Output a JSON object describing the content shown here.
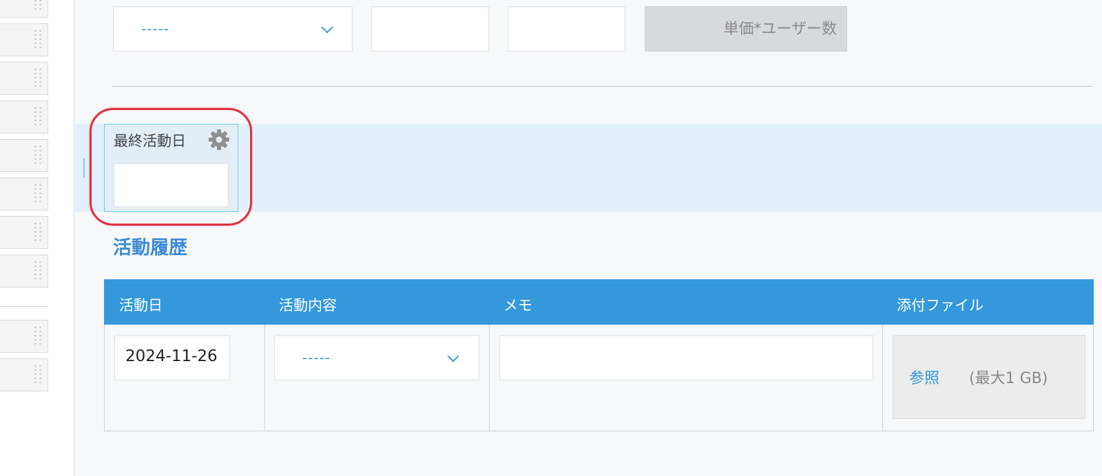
{
  "form": {
    "top_row": {
      "select_value": "-----",
      "calc_field_text": "単価*ユーザー数"
    },
    "selected_field": {
      "label": "最終活動日",
      "icon": "gear-icon"
    },
    "section_title": "活動履歴",
    "table": {
      "headers": [
        "活動日",
        "活動内容",
        "メモ",
        "添付ファイル"
      ],
      "row": {
        "date": "2024-11-26",
        "content_select": "-----",
        "memo": "",
        "browse_label": "参照",
        "max_size": "(最大1 GB)"
      }
    }
  },
  "colors": {
    "accent": "#3498db",
    "highlight": "#e0303f",
    "selected_row_bg": "#e1f0fb"
  }
}
